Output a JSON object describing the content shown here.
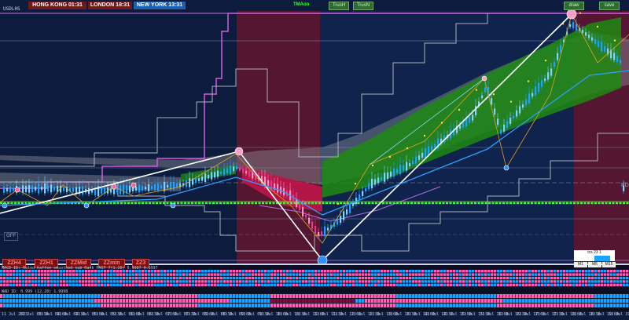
{
  "symbol": "USDLHS",
  "clocks": [
    {
      "label": "HONG KONG 01:31",
      "bg": "#6e1a1a"
    },
    {
      "label": "LONDON  18:31",
      "bg": "#6e1a1a"
    },
    {
      "label": "NEW YORK  13:31",
      "bg": "#1f5fb0"
    }
  ],
  "toolbar": {
    "tma_label": "TMAon",
    "btn1_label": "TrusH",
    "btn2_label": "TrusN",
    "right1_label": "draw",
    "right2_label": "save"
  },
  "zz_buttons": [
    "ZZH4",
    "ZZH1",
    "ZZMid",
    "ZZmin",
    "ZZ3"
  ],
  "off_label": "OFF",
  "pd_label": "PD",
  "panel": {
    "row1": "tcs 23  1",
    "row3": [
      "M1",
      "M5",
      "M15"
    ]
  },
  "indicators": {
    "label1": "MACD ID: Rated  Kaffee  smoothed  sub  Rank  PAST  7(1.20)  0.9997  0.9997",
    "label2": "WAD  ID: 0.999  (12.20)  1.9998"
  },
  "xaxis": {
    "ticks": [
      "11 Jul 2023",
      "11 Jul 03:30",
      "11 Jul 04:00",
      "11 Jul 04:30",
      "11 Jul 05:00",
      "11 Jul 05:30",
      "11 Jul 06:00",
      "11 Jul 06:30",
      "11 Jul 07:00",
      "11 Jul 07:30",
      "11 Jul 08:00",
      "11 Jul 08:30",
      "11 Jul 09:00",
      "11 Jul 09:30",
      "11 Jul 10:00",
      "11 Jul 10:30",
      "11 Jul 11:00",
      "11 Jul 11:30",
      "11 Jul 12:00",
      "11 Jul 12:30",
      "11 Jul 13:00",
      "11 Jul 13:30",
      "11 Jul 14:00",
      "11 Jul 14:30",
      "11 Jul 15:00",
      "11 Jul 15:30",
      "11 Jul 16:00",
      "11 Jul 16:30",
      "11 Jul 17:00",
      "11 Jul 17:30",
      "11 Jul 18:00",
      "11 Jul 18:30",
      "11 Jul 19:00",
      "11 Jul 19:30"
    ]
  },
  "colors": {
    "background": "#0d1b3d",
    "session_red": "#5a1630",
    "bull_green": "#1f8a12",
    "bear_red": "#c4154a",
    "band_gray": "#8a8f96",
    "pink_line": "#d35de0",
    "green_level": "#33ff33",
    "bar_blue": "#1aa3ff",
    "bar_pink": "#ff5fb3"
  }
}
